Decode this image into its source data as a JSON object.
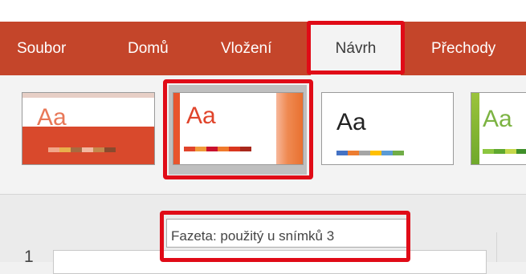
{
  "ribbon": {
    "tabs": [
      {
        "label": "Soubor"
      },
      {
        "label": "Domů"
      },
      {
        "label": "Vložení"
      },
      {
        "label": "Návrh"
      },
      {
        "label": "Přechody"
      }
    ],
    "active_tab": "Návrh",
    "background": "#c4452a"
  },
  "themes": [
    {
      "sample": "Aa"
    },
    {
      "sample": "Aa"
    },
    {
      "sample": "Aa"
    },
    {
      "sample": "Aa"
    }
  ],
  "tooltip": {
    "text": "Fazeta: použitý u snímků 3"
  },
  "slides": [
    {
      "number": "1"
    }
  ],
  "colors": {
    "highlight": "#e00b17",
    "accent": "#c4452a"
  }
}
